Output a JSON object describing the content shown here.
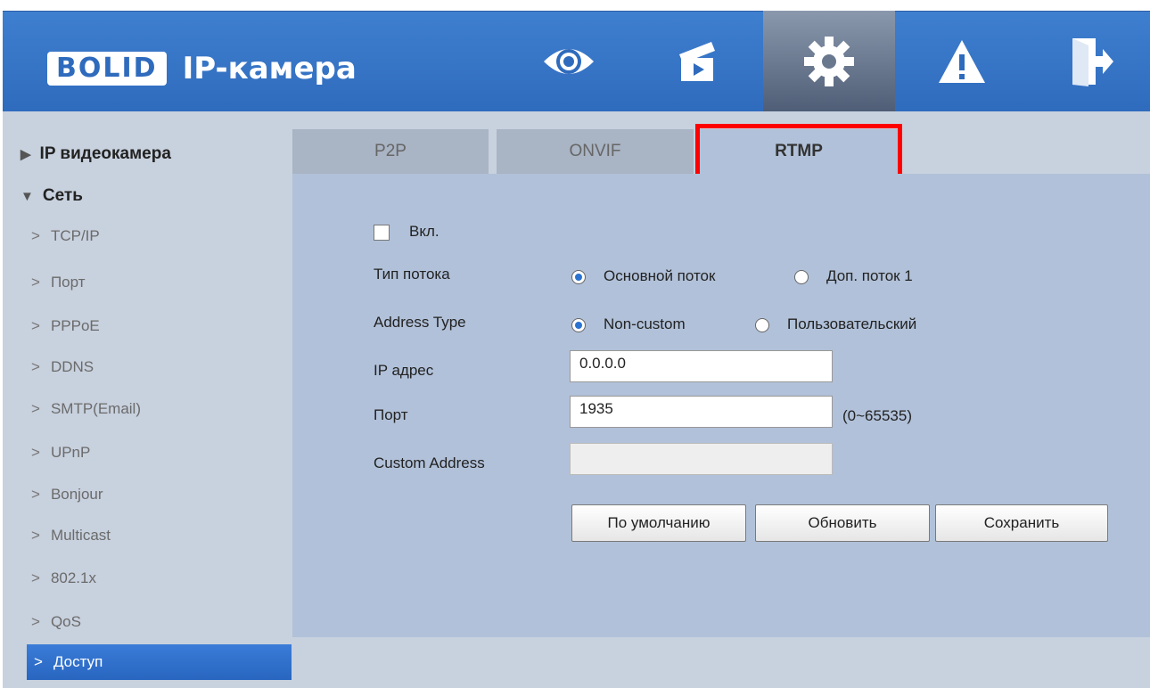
{
  "header": {
    "logo": "BOLID",
    "title": "IP-камера",
    "nav": [
      "live-view-eye-icon",
      "playback-clapperboard-icon",
      "settings-gear-icon",
      "alarm-warning-icon",
      "logout-door-icon"
    ]
  },
  "sidebar": {
    "section_ipcamera": "IP видеокамера",
    "section_network": "Сеть",
    "items": [
      "TCP/IP",
      "Порт",
      "PPPoE",
      "DDNS",
      "SMTP(Email)",
      "UPnP",
      "Bonjour",
      "Multicast",
      "802.1x",
      "QoS",
      "Доступ"
    ]
  },
  "tabs": [
    "P2P",
    "ONVIF",
    "RTMP"
  ],
  "form": {
    "enable_label": "Вкл.",
    "stream_type_label": "Тип потока",
    "stream_main": "Основной поток",
    "stream_sub": "Доп. поток 1",
    "address_type_label": "Address Type",
    "addr_noncustom": "Non-custom",
    "addr_custom": "Пользовательский",
    "ip_label": "IP адрес",
    "ip_value": "0.0.0.0",
    "port_label": "Порт",
    "port_value": "1935",
    "port_range": "(0~65535)",
    "custom_address_label": "Custom Address",
    "custom_address_value": ""
  },
  "buttons": {
    "default": "По умолчанию",
    "refresh": "Обновить",
    "save": "Сохранить"
  },
  "colors": {
    "header_blue": "#2f6bbd",
    "panel": "#b1c1d9",
    "highlight": "#ff0000",
    "active_item": "#2866c0"
  }
}
